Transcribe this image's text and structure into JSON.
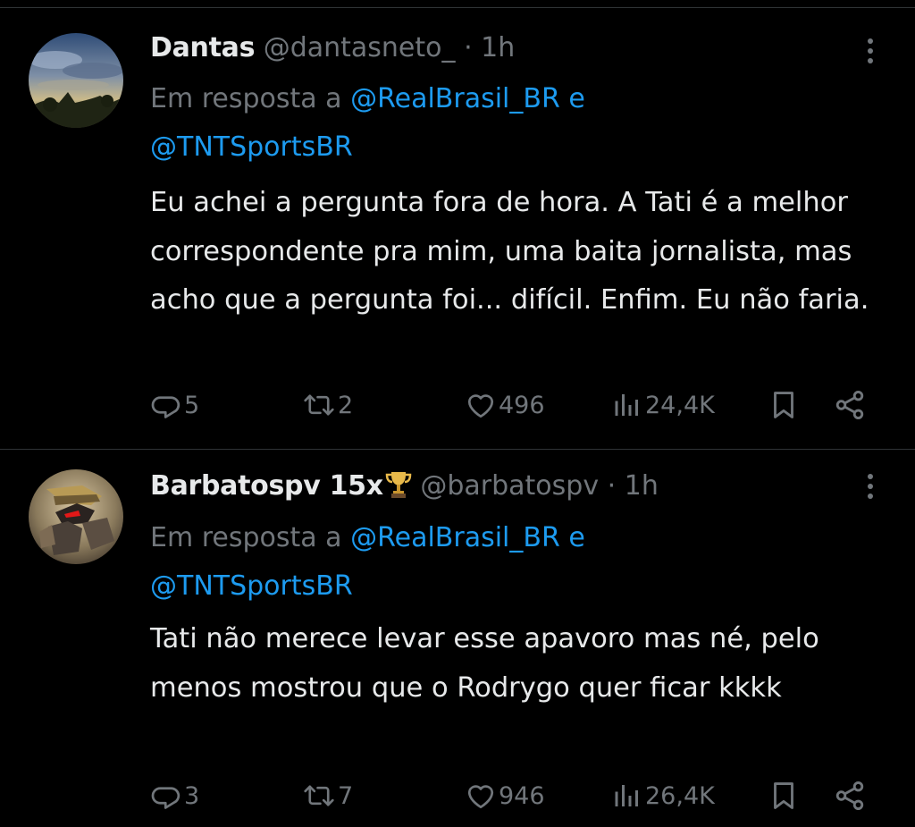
{
  "tweets": [
    {
      "name": "Dantas",
      "handle": "@dantasneto_",
      "dot": "·",
      "time": "1h",
      "reply_prefix": "Em resposta a",
      "mention1": "@RealBrasil_BR",
      "conj": "e",
      "mention2": "@TNTSportsBR",
      "text": "Eu achei a pergunta fora de hora. A Tati é a melhor correspondente pra mim, uma baita jornalista, mas acho que a pergunta foi... difícil. Enfim. Eu não faria.",
      "replies": "5",
      "retweets": "2",
      "likes": "496",
      "views": "24,4K"
    },
    {
      "name": "Barbatospv 15x",
      "name_icon": "trophy-icon",
      "handle": "@barbatospv",
      "dot": "·",
      "time": "1h",
      "reply_prefix": "Em resposta a",
      "mention1": "@RealBrasil_BR",
      "conj": "e",
      "mention2": "@TNTSportsBR",
      "text": "Tati não merece levar esse apavoro mas né, pelo menos mostrou que o Rodrygo quer ficar kkkk",
      "replies": "3",
      "retweets": "7",
      "likes": "946",
      "views": "26,4K"
    }
  ],
  "colors": {
    "background": "#000000",
    "text": "#e7e9ea",
    "muted": "#71767b",
    "link": "#1d9bf0",
    "divider": "#2f3336"
  }
}
